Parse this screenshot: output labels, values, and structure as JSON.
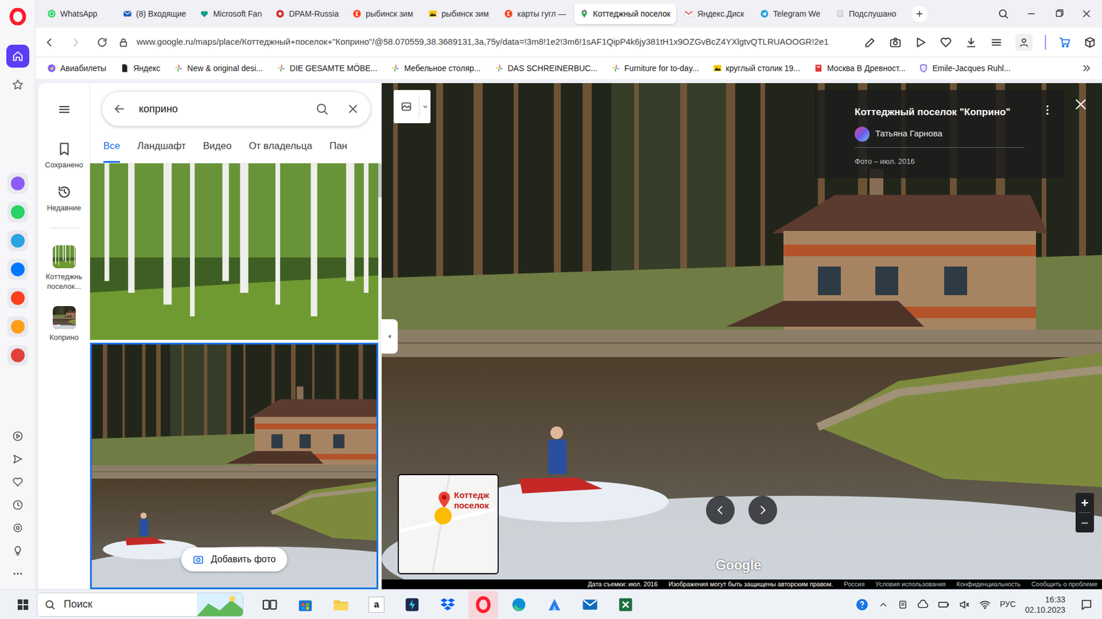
{
  "opera_sidebar": {
    "top": [
      {
        "kind": "home",
        "selected": true
      },
      {
        "kind": "star",
        "selected": false
      }
    ],
    "apps": [
      {
        "kind": "aria",
        "selected": false
      },
      {
        "kind": "whatsapp",
        "selected": false
      },
      {
        "kind": "telegram",
        "selected": false
      },
      {
        "kind": "vk",
        "selected": false
      },
      {
        "kind": "yandex",
        "selected": false
      },
      {
        "kind": "mail",
        "selected": false
      },
      {
        "kind": "app",
        "selected": false
      }
    ],
    "bottom": [
      {
        "kind": "play",
        "selected": false
      },
      {
        "kind": "send",
        "selected": false
      },
      {
        "kind": "heart",
        "selected": false
      },
      {
        "kind": "clock",
        "selected": false
      },
      {
        "kind": "gear",
        "selected": false
      },
      {
        "kind": "bulb",
        "selected": false
      },
      {
        "kind": "more",
        "selected": false
      }
    ]
  },
  "browser": {
    "tabs": [
      {
        "label": "WhatsApp",
        "kind": "whatsapp",
        "selected": false
      },
      {
        "label": "(8) Входящие",
        "kind": "mail",
        "selected": false
      },
      {
        "label": "Microsoft Fan",
        "kind": "family",
        "selected": false
      },
      {
        "label": "DPAM-Russia",
        "kind": "dpam",
        "selected": false
      },
      {
        "label": "рыбинск зим",
        "kind": "yandex",
        "selected": false
      },
      {
        "label": "рыбинск зим",
        "kind": "image",
        "selected": false
      },
      {
        "label": "карты гугл —",
        "kind": "yandex",
        "selected": false
      },
      {
        "label": "Коттеджный поселок",
        "kind": "maps",
        "selected": true
      },
      {
        "label": "Яндекс.Диск",
        "kind": "gmail",
        "selected": false
      },
      {
        "label": "Telegram We",
        "kind": "telegram",
        "selected": false
      },
      {
        "label": "Подслушано",
        "kind": "page",
        "selected": false
      }
    ],
    "url": "www.google.ru/maps/place/Коттеджный+поселок+\"Коприно\"/@58.070559,38.3689131,3a,75y/data=!3m8!1e2!3m6!1sAF1QipP4k6jy381tH1x9OZGvBcZ4YXlgtvQTLRUAOOGR!2e1",
    "bookmarks": [
      {
        "label": "Авиабилеты",
        "kind": "plane"
      },
      {
        "label": "Яндекс",
        "kind": "doc"
      },
      {
        "label": "New & original desi...",
        "kind": "pinwheel"
      },
      {
        "label": "DIE GESAMTE MÖBE...",
        "kind": "pinwheel"
      },
      {
        "label": "Мебельное столяр...",
        "kind": "pinwheel"
      },
      {
        "label": "DAS SCHREINERBUC...",
        "kind": "pinwheel"
      },
      {
        "label": "Furniture for to-day...",
        "kind": "pinwheel"
      },
      {
        "label": "круглый столик 19...",
        "kind": "image"
      },
      {
        "label": "Москва В Древност...",
        "kind": "redf"
      },
      {
        "label": "Emile-Jacques Ruhl...",
        "kind": "shield"
      }
    ]
  },
  "maps": {
    "search": {
      "value": "коприно"
    },
    "tabs": [
      {
        "label": "Все",
        "selected": true
      },
      {
        "label": "Ландшафт",
        "selected": false
      },
      {
        "label": "Видео",
        "selected": false
      },
      {
        "label": "От владельца",
        "selected": false
      },
      {
        "label": "Пан",
        "selected": false
      }
    ],
    "nav": [
      {
        "label": "Сохранено",
        "kind": "bookmark"
      },
      {
        "label": "Недавние",
        "kind": "history"
      },
      {
        "label": "Коттеджнь поселок...",
        "kind": "thumb-forest"
      },
      {
        "label": "Коприно",
        "kind": "thumb-lake"
      }
    ],
    "photos": [
      {
        "kind": "forest",
        "selected": false
      },
      {
        "kind": "lake",
        "selected": true
      }
    ],
    "add_photo": "Добавить фото"
  },
  "viewer": {
    "title": "Коттеджный поселок \"Коприно\"",
    "author": "Татьяна Гарнова",
    "date": "Фото – июл. 2016",
    "minimap_label": "Коттедж поселок",
    "watermark": "Google",
    "zoom_in": "+",
    "zoom_out": "−",
    "footer": [
      {
        "label": "Дата съемки: июл. 2016",
        "kind": "info"
      },
      {
        "label": "Изображения могут быть защищены авторским правом.",
        "kind": "info"
      },
      {
        "label": "Россия",
        "kind": "link"
      },
      {
        "label": "Условия использования",
        "kind": "link"
      },
      {
        "label": "Конфиденциальность",
        "kind": "link"
      },
      {
        "label": "Сообщить о проблеме",
        "kind": "link"
      }
    ]
  },
  "taskbar": {
    "search": "Поиск",
    "apps": [
      {
        "kind": "taskview",
        "label": "",
        "selected": false
      },
      {
        "kind": "store",
        "label": "",
        "selected": false
      },
      {
        "kind": "explorer",
        "label": "",
        "selected": false
      },
      {
        "kind": "amazon",
        "label": "a",
        "selected": false
      },
      {
        "kind": "darkapp",
        "label": "",
        "selected": false
      },
      {
        "kind": "dropbox",
        "label": "",
        "selected": false
      },
      {
        "kind": "opera",
        "label": "",
        "selected": true
      },
      {
        "kind": "edge",
        "label": "",
        "selected": false
      },
      {
        "kind": "blueapp",
        "label": "",
        "selected": false
      },
      {
        "kind": "mailapp",
        "label": "",
        "selected": false
      },
      {
        "kind": "excel",
        "label": "",
        "selected": false
      }
    ],
    "lang": "РУС",
    "time": "16:33",
    "date": "02.10.2023"
  }
}
